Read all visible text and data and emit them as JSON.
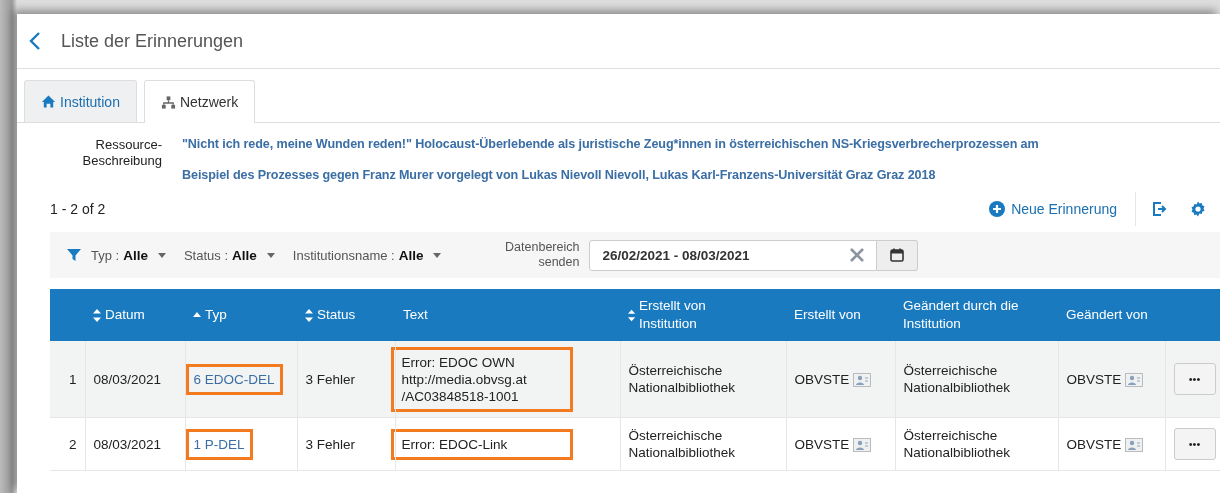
{
  "title": "Liste der Erinnerungen",
  "tabs": [
    {
      "label": "Institution",
      "selected": false
    },
    {
      "label": "Netzwerk",
      "selected": true
    }
  ],
  "resource": {
    "label": "Ressource-Beschreibung",
    "lines": [
      "\"Nicht ich rede, meine Wunden reden!\" Holocaust-Überlebende als juristische Zeug*innen in österreichischen NS-Kriegsverbrecherprozessen am",
      "Beispiel des Prozesses gegen Franz Murer vorgelegt von Lukas Nievoll Nievoll, Lukas Karl-Franzens-Universität Graz Graz 2018"
    ]
  },
  "count": "1 - 2 of 2",
  "new_button": "Neue Erinnerung",
  "filters": [
    {
      "label": "Typ :",
      "value": "Alle"
    },
    {
      "label": "Status :",
      "value": "Alle"
    },
    {
      "label": "Institutionsname :",
      "value": "Alle"
    }
  ],
  "date_range": {
    "label": "Datenbereich senden",
    "value": "26/02/2021 - 08/03/2021"
  },
  "table": {
    "columns": [
      {
        "label": "Datum",
        "sortable": true
      },
      {
        "label": "Typ",
        "sorted": true
      },
      {
        "label": "Status",
        "sortable": true
      },
      {
        "label": "Text",
        "sortable": false
      },
      {
        "label": "Erstellt von Institution",
        "sortable": true
      },
      {
        "label": "Erstellt von",
        "sortable": false
      },
      {
        "label": "Geändert durch die Institution",
        "sortable": false
      },
      {
        "label": "Geändert von",
        "sortable": false
      }
    ],
    "rows": [
      {
        "num": "1",
        "date": "08/03/2021",
        "type": "6 EDOC-DEL",
        "type_highlighted": true,
        "status": "3 Fehler",
        "text": [
          "Error: EDOC OWN",
          "http://media.obvsg.at",
          "/AC03848518-1001"
        ],
        "text_highlighted": true,
        "created_inst": "Österreichische Nationalbibliothek",
        "created_by": "OBVSTE",
        "changed_inst": "Österreichische Nationalbibliothek",
        "changed_by": "OBVSTE",
        "action": "•••"
      },
      {
        "num": "2",
        "date": "08/03/2021",
        "type": "1 P-DEL",
        "type_highlighted": true,
        "status": "3 Fehler",
        "text": [
          "Error: EDOC-Link"
        ],
        "text_highlighted": true,
        "created_inst": "Österreichische Nationalbibliothek",
        "created_by": "OBVSTE",
        "changed_inst": "Österreichische Nationalbibliothek",
        "changed_by": "OBVSTE",
        "action": "•••"
      }
    ]
  }
}
